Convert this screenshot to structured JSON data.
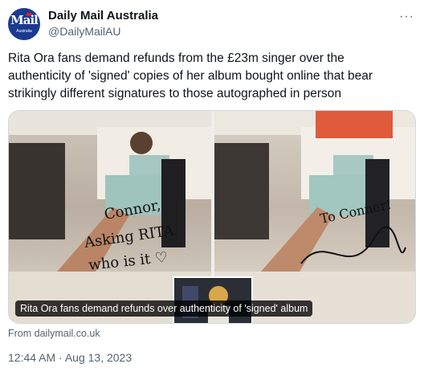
{
  "account": {
    "name": "Daily Mail Australia",
    "handle": "@DailyMailAU",
    "avatar_logo": "Mail",
    "avatar_sub": "Australia"
  },
  "more_icon": "more-horizontal-icon",
  "tweet_text": "Rita Ora fans demand refunds from the £23m singer over the authenticity of 'signed' copies of her album bought online that bear strikingly different signatures to those autographed in person",
  "card": {
    "caption": "Rita Ora fans demand refunds over authenticity of 'signed' album",
    "source": "From dailymail.co.uk"
  },
  "timestamp": "12:44 AM · Aug 13, 2023",
  "colors": {
    "text": "#0f1419",
    "secondary": "#536471",
    "avatar_bg": "#1a3a8f"
  }
}
